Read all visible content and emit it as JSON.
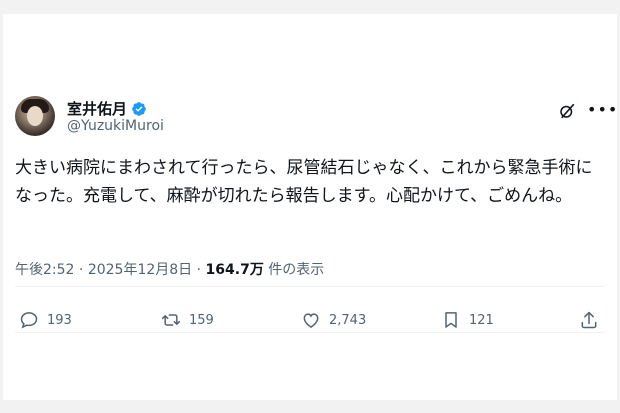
{
  "author": {
    "display_name": "室井佑月",
    "handle": "@YuzukiMuroi",
    "verified": true
  },
  "tweet": {
    "text": "大きい病院にまわされて行ったら、尿管結石じゃなく、これから緊急手術になった。充電して、麻酔が切れたら報告します。心配かけて、ごめんね。",
    "time": "午後2:52",
    "date": "2025年12月8日",
    "views_count": "164.7万",
    "views_label": "件の表示",
    "sep": "·"
  },
  "actions": {
    "replies": "193",
    "reposts": "159",
    "likes": "2,743",
    "bookmarks": "121"
  },
  "icons": [
    "verified-icon",
    "grok-icon",
    "more-icon",
    "reply-icon",
    "repost-icon",
    "like-icon",
    "bookmark-icon",
    "share-icon"
  ],
  "colors": {
    "verified": "#1d9bf0",
    "secondary_text": "#536471",
    "text": "#0f1419"
  }
}
